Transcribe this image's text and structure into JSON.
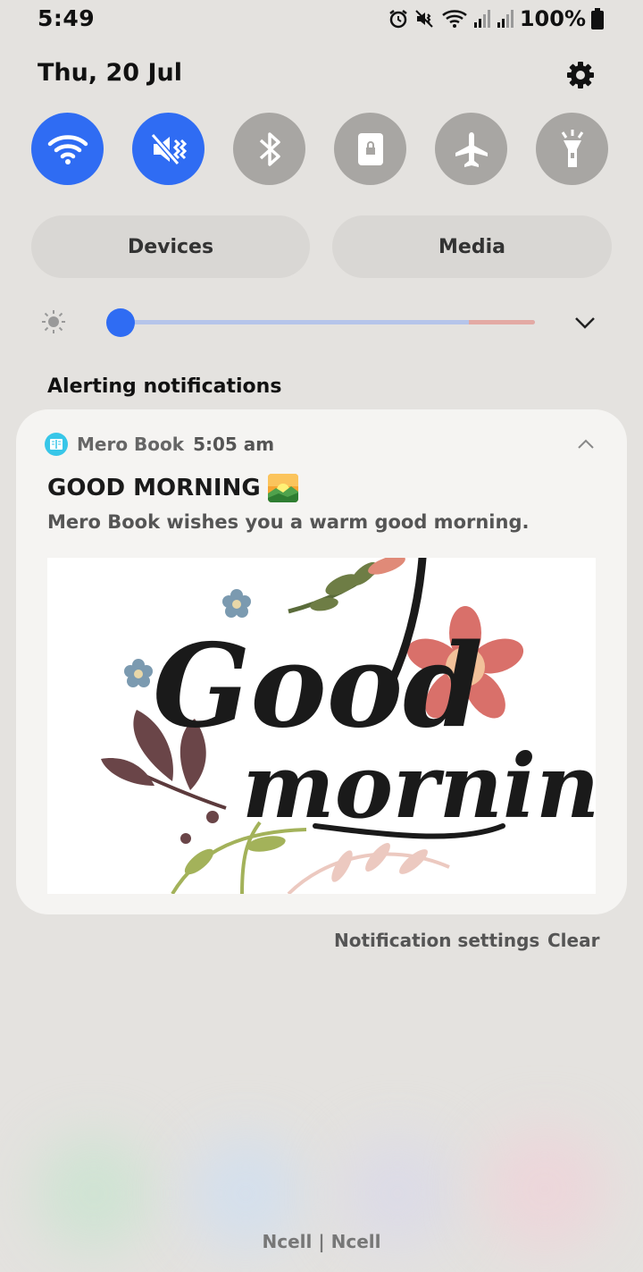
{
  "status_bar": {
    "time": "5:49",
    "battery": "100%",
    "icons": [
      "alarm-icon",
      "mute-icon",
      "wifi-icon",
      "signal-icon",
      "signal-icon",
      "battery-icon"
    ]
  },
  "header": {
    "date": "Thu, 20 Jul",
    "settings_icon": "gear-icon"
  },
  "quick_settings": [
    {
      "name": "wifi",
      "icon": "wifi-icon",
      "active": true
    },
    {
      "name": "mute",
      "icon": "mute-vibrate-icon",
      "active": true
    },
    {
      "name": "bluetooth",
      "icon": "bluetooth-icon",
      "active": false
    },
    {
      "name": "lock",
      "icon": "lock-rotation-icon",
      "active": false
    },
    {
      "name": "airplane",
      "icon": "airplane-icon",
      "active": false
    },
    {
      "name": "flashlight",
      "icon": "flashlight-icon",
      "active": false
    }
  ],
  "pills": {
    "devices": "Devices",
    "media": "Media"
  },
  "brightness": {
    "level": 0.02
  },
  "notifications": {
    "section_title": "Alerting notifications",
    "items": [
      {
        "app_name": "Mero Book",
        "time": "5:05 am",
        "title": "GOOD MORNING",
        "body": "Mero Book wishes you a warm good morning.",
        "image_alt_text": "Good morning"
      }
    ]
  },
  "actions": {
    "settings": "Notification settings",
    "clear": "Clear"
  },
  "carrier": "Ncell | Ncell",
  "colors": {
    "accent": "#2f6cf3",
    "inactive": "#a8a6a3",
    "background": "#e4e2df"
  }
}
